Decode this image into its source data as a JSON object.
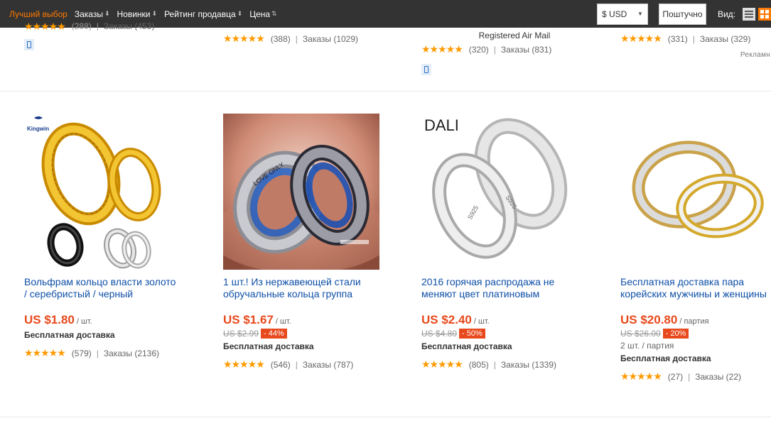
{
  "sortbar": {
    "items": [
      {
        "label": "Лучший выбор",
        "active": true
      },
      {
        "label": "Заказы",
        "active": false
      },
      {
        "label": "Новинки",
        "active": false
      },
      {
        "label": "Рейтинг продавца",
        "active": false
      },
      {
        "label": "Цена",
        "active": false
      }
    ],
    "currency": "$ USD",
    "shipping_button": "Поштучно",
    "view_label": "Вид:",
    "view_modes": [
      "list",
      "grid"
    ],
    "active_view": "grid"
  },
  "row1": {
    "items": [
      {
        "rating": "",
        "orders": ""
      },
      {
        "rating": "(388)",
        "orders": "Заказы (1029)"
      },
      {
        "note": "Registered Air Mail",
        "rating": "(320)",
        "orders": "Заказы (831)"
      },
      {
        "rating": "(331)",
        "orders": "Заказы (329)"
      }
    ],
    "ad_label": "Рекламн"
  },
  "products": [
    {
      "title": "Вольфрам кольцо власти золото / серебристый / черный",
      "price": "US $1.80",
      "unit": "/ шт.",
      "old_price": "",
      "discount": "",
      "lot": "",
      "shipping": "Бесплатная доставка",
      "rating": "(579)",
      "orders": "Заказы (2136)",
      "brand_mark": "Kingwin"
    },
    {
      "title": "1 шт.! Из нержавеющей стали обручальные кольца группа",
      "price": "US $1.67",
      "unit": "/ шт.",
      "old_price": "US $2.99",
      "discount": "- 44%",
      "lot": "",
      "shipping": "Бесплатная доставка",
      "rating": "(546)",
      "orders": "Заказы (787)",
      "engraving": "LOVE ONLY"
    },
    {
      "title": "2016 горячая распродажа не меняют цвет платиновым",
      "price": "US $2.40",
      "unit": "/ шт.",
      "old_price": "US $4.80",
      "discount": "- 50%",
      "lot": "",
      "shipping": "Бесплатная доставка",
      "rating": "(805)",
      "orders": "Заказы (1339)",
      "brand_mark": "DALI",
      "engraving": "S925"
    },
    {
      "title": "Бесплатная доставка пара корейских мужчины и женщины",
      "price": "US $20.80",
      "unit": "/ партия",
      "old_price": "US $26.00",
      "discount": "- 20%",
      "lot": "2 шт. / партия",
      "shipping": "Бесплатная доставка",
      "rating": "(27)",
      "orders": "Заказы (22)"
    }
  ],
  "colors": {
    "accent": "#ff7a00",
    "price": "#e8491c",
    "link": "#0e4fa6",
    "stars": "#ff9a00",
    "bar": "#333333"
  }
}
